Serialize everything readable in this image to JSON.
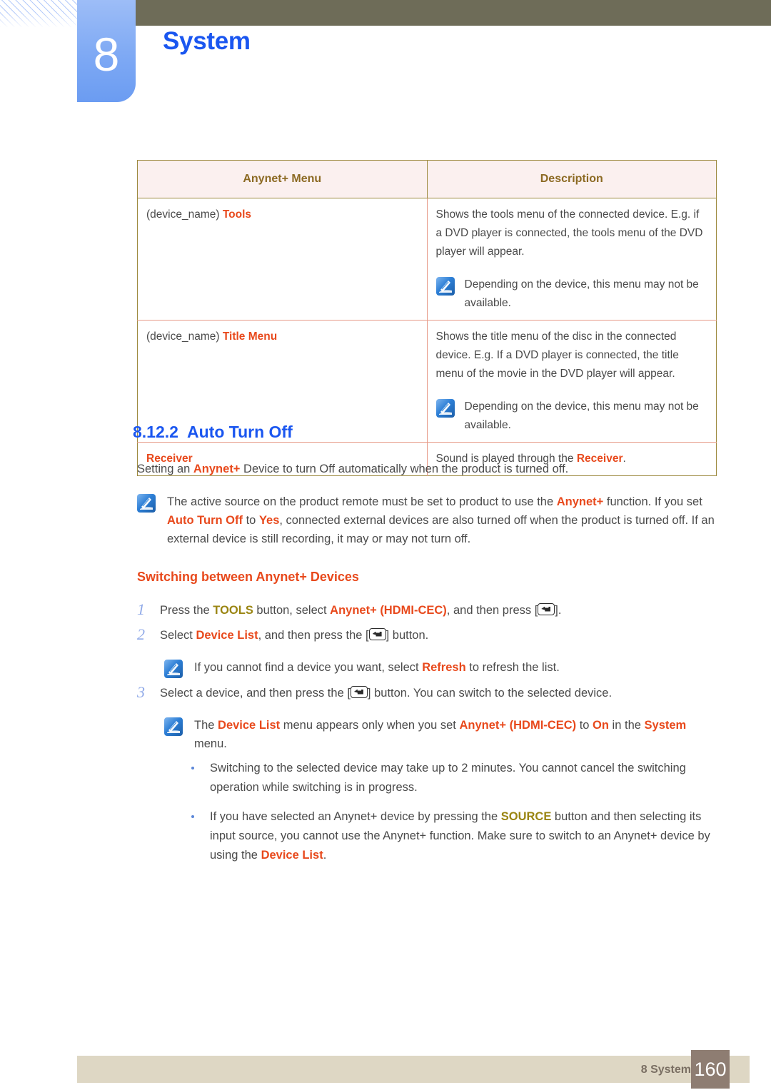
{
  "header": {
    "chapter_number": "8",
    "chapter_title": "System"
  },
  "table": {
    "columns": [
      "Anynet+ Menu",
      "Description"
    ],
    "rows": [
      {
        "menu_prefix": "(device_name)",
        "menu_name": "Tools",
        "description": "Shows the tools menu of the connected device. E.g. if a DVD player is connected, the tools menu of the DVD player will appear.",
        "note": "Depending on the device, this menu may not be available."
      },
      {
        "menu_prefix": "(device_name)",
        "menu_name": "Title Menu",
        "description": "Shows the title menu of the disc in the connected device. E.g. If a DVD player is connected, the title menu of the movie in the DVD player will appear.",
        "note": "Depending on the device, this menu may not be available."
      },
      {
        "menu_prefix": "",
        "menu_name": "Receiver",
        "description_pre": "Sound is played through the ",
        "description_hl": "Receiver",
        "description_post": ".",
        "note": ""
      }
    ]
  },
  "section": {
    "number": "8.12.2",
    "title": "Auto Turn Off",
    "intro_pre": "Setting an ",
    "intro_hl": "Anynet+",
    "intro_post": " Device to turn Off automatically when the product is turned off.",
    "note": {
      "p1": "The active source on the product remote must be set to product to use the ",
      "hl1": "Anynet+",
      "p2": " function. If you set ",
      "hl2": "Auto Turn Off",
      "p3": " to ",
      "hl3": "Yes",
      "p4": ", connected external devices are also turned off when the product is turned off. If an external device is still recording, it may or may not turn off."
    }
  },
  "subsection": {
    "title": "Switching between Anynet+ Devices",
    "steps": [
      {
        "num": "1",
        "pre": "Press the ",
        "hl_y": "TOOLS",
        "mid": " button, select ",
        "hl": "Anynet+ (HDMI-CEC)",
        "post": ", and then press [",
        "tail": "]."
      },
      {
        "num": "2",
        "pre": "Select ",
        "hl": "Device List",
        "post": ", and then press the [",
        "tail": "] button."
      },
      {
        "num": "3",
        "pre": "Select a device, and then press the [",
        "post": "",
        "tail": "] button. You can switch to the selected device."
      }
    ],
    "note_refresh": {
      "pre": "If you cannot find a device you want, select ",
      "hl": "Refresh",
      "post": " to refresh the list."
    },
    "note_devicelist": {
      "p1": "The ",
      "hl1": "Device List",
      "p2": " menu appears only when you set ",
      "hl2": "Anynet+ (HDMI-CEC)",
      "p3": " to ",
      "hl3": "On",
      "p4": " in the ",
      "hl4": "System",
      "p5": " menu."
    },
    "bullets": [
      {
        "text": "Switching to the selected device may take up to 2 minutes. You cannot cancel the switching operation while switching is in progress."
      },
      {
        "pre": "If you have selected an Anynet+ device by pressing the ",
        "hl_y": "SOURCE",
        "mid": " button and then selecting its input source, you cannot use the Anynet+ function. Make sure to switch to an Anynet+ device by using the ",
        "hl": "Device List",
        "post": "."
      }
    ]
  },
  "footer": {
    "label": "8 System",
    "page": "160"
  },
  "colors": {
    "accent_blue": "#1a56f0",
    "highlight_orange": "#e8491c",
    "highlight_yellow": "#9a8512",
    "olive_bar": "#6e6c58",
    "tab_blue": "#7ea9f4",
    "footer_bar": "#ded7c4",
    "footer_page_box": "#8e7d72",
    "table_border": "#9d8a3f",
    "table_header_bg": "#fbf0ef"
  },
  "icons": {
    "note": "note-pen-icon",
    "enter": "enter-key-icon"
  }
}
